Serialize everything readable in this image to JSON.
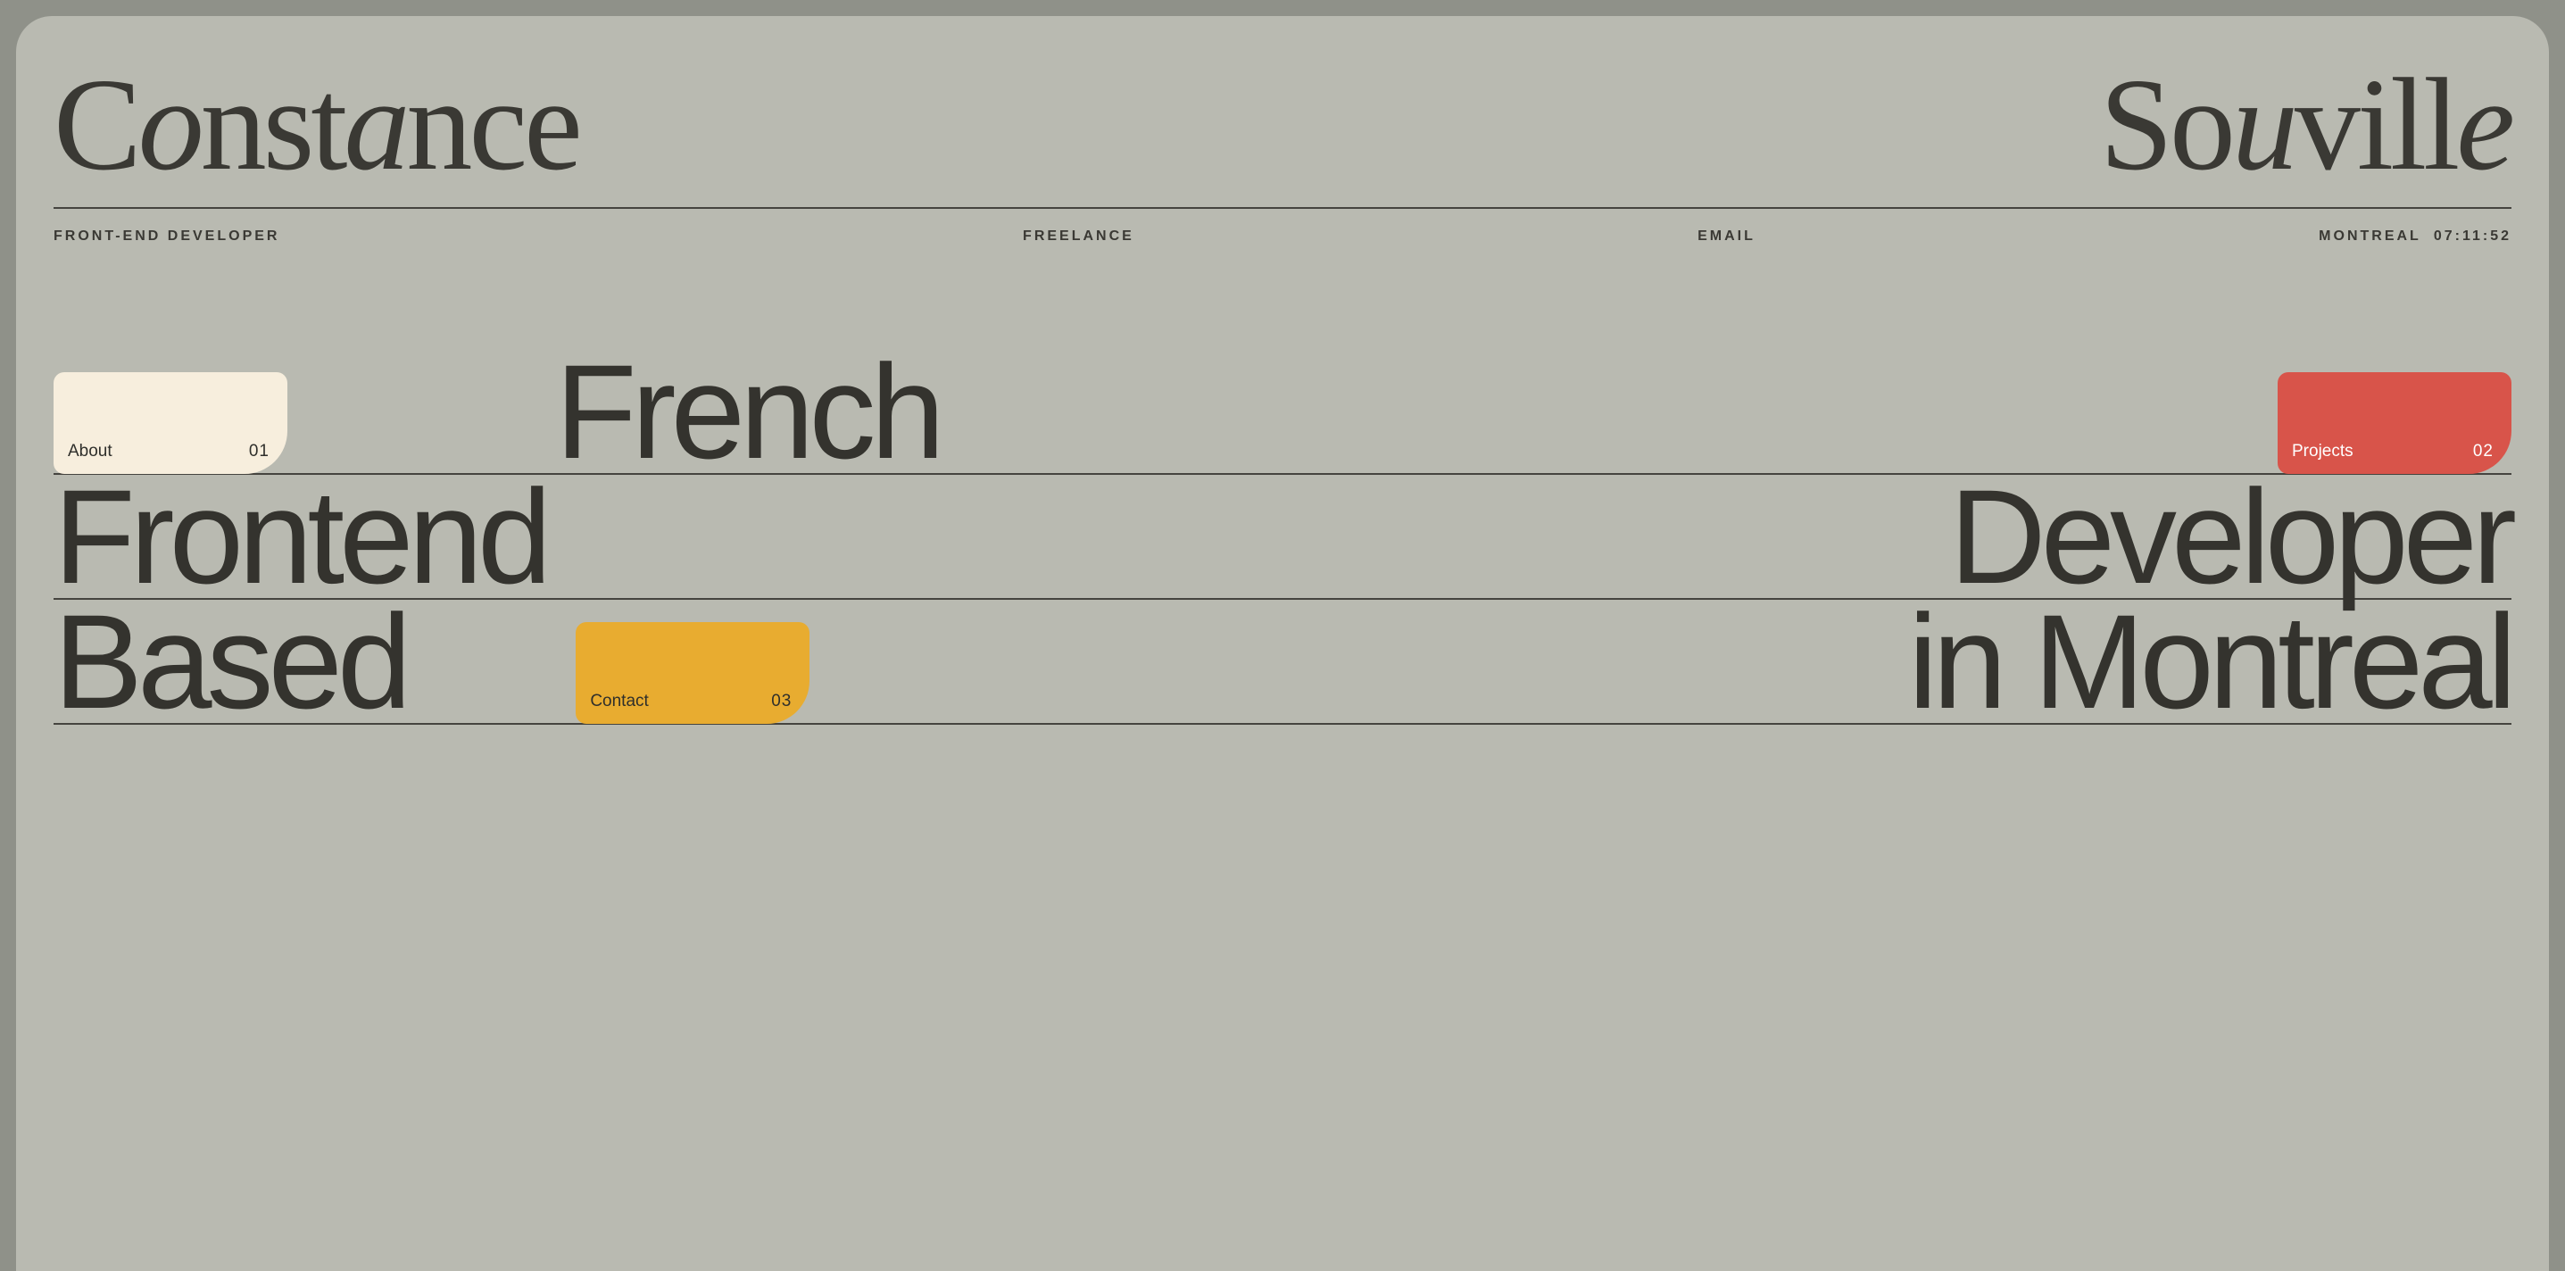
{
  "header": {
    "first_name_html": "C<em>o</em>nst<em>a</em>nce",
    "last_name_html": "So<em>u</em>vill<em>e</em>",
    "first_name": "Constance",
    "last_name": "Souville"
  },
  "meta": {
    "role": "FRONT-END DEVELOPER",
    "status": "FREELANCE",
    "email": "EMAIL",
    "location": "MONTREAL",
    "time": "07:11:52"
  },
  "cards": {
    "about": {
      "label": "About",
      "num": "01"
    },
    "projects": {
      "label": "Projects",
      "num": "02"
    },
    "contact": {
      "label": "Contact",
      "num": "03"
    }
  },
  "hero": {
    "w1": "French",
    "w2": "Frontend",
    "w3": "Developer",
    "w4": "Based",
    "w5": "in Montreal"
  }
}
